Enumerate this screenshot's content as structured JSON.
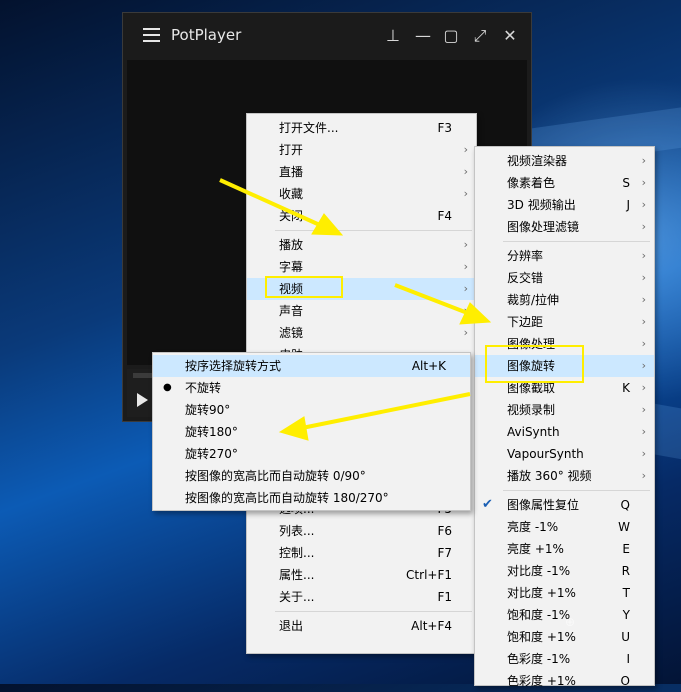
{
  "window": {
    "title": "PotPlayer",
    "buttons": [
      {
        "name": "pin-icon",
        "glyph": "⊥"
      },
      {
        "name": "minimize-icon",
        "glyph": "—"
      },
      {
        "name": "maximize-icon",
        "glyph": "▢"
      },
      {
        "name": "fullscreen-icon",
        "glyph": "⤢"
      },
      {
        "name": "close-icon",
        "glyph": "✕"
      }
    ]
  },
  "main_menu": [
    {
      "label": "打开文件...",
      "shortcut": "F3",
      "arrow": false
    },
    {
      "label": "打开",
      "shortcut": "",
      "arrow": true
    },
    {
      "label": "直播",
      "shortcut": "",
      "arrow": true
    },
    {
      "label": "收藏",
      "shortcut": "",
      "arrow": true
    },
    {
      "label": "关闭",
      "shortcut": "F4",
      "arrow": false,
      "sep_after": true
    },
    {
      "label": "播放",
      "shortcut": "",
      "arrow": true
    },
    {
      "label": "字幕",
      "shortcut": "",
      "arrow": true
    },
    {
      "label": "视频",
      "shortcut": "",
      "arrow": true,
      "highlight": true
    },
    {
      "label": "声音",
      "shortcut": "",
      "arrow": true
    },
    {
      "label": "滤镜",
      "shortcut": "",
      "arrow": true
    },
    {
      "label": "皮肤",
      "shortcut": "",
      "arrow": true
    },
    {
      "label": "",
      "shortcut": "",
      "arrow": false
    },
    {
      "label": "",
      "shortcut": "",
      "arrow": false
    },
    {
      "label": "",
      "shortcut": "",
      "arrow": false
    },
    {
      "label": "",
      "shortcut": "",
      "arrow": false
    },
    {
      "label": "",
      "shortcut": "",
      "arrow": false
    },
    {
      "label": "",
      "shortcut": "",
      "arrow": false
    },
    {
      "label": "选项...",
      "shortcut": "F5",
      "arrow": false
    },
    {
      "label": "列表...",
      "shortcut": "F6",
      "arrow": false
    },
    {
      "label": "控制...",
      "shortcut": "F7",
      "arrow": false
    },
    {
      "label": "属性...",
      "shortcut": "Ctrl+F1",
      "arrow": false
    },
    {
      "label": "关于...",
      "shortcut": "F1",
      "arrow": false,
      "sep_after": true
    },
    {
      "label": "退出",
      "shortcut": "Alt+F4",
      "arrow": false
    }
  ],
  "video_submenu": [
    {
      "label": "视频渲染器",
      "shortcut": "",
      "arrow": true
    },
    {
      "label": "像素着色",
      "shortcut": "S",
      "arrow": true
    },
    {
      "label": "3D 视频输出",
      "shortcut": "J",
      "arrow": true
    },
    {
      "label": "图像处理滤镜",
      "shortcut": "",
      "arrow": true,
      "sep_after": true
    },
    {
      "label": "分辨率",
      "shortcut": "",
      "arrow": true
    },
    {
      "label": "反交错",
      "shortcut": "",
      "arrow": true
    },
    {
      "label": "裁剪/拉伸",
      "shortcut": "",
      "arrow": true
    },
    {
      "label": "下边距",
      "shortcut": "",
      "arrow": true
    },
    {
      "label": "图像处理",
      "shortcut": "",
      "arrow": true
    },
    {
      "label": "图像旋转",
      "shortcut": "",
      "arrow": true,
      "highlight": true
    },
    {
      "label": "图像截取",
      "shortcut": "K",
      "arrow": true
    },
    {
      "label": "视频录制",
      "shortcut": "",
      "arrow": true
    },
    {
      "label": "AviSynth",
      "shortcut": "",
      "arrow": true
    },
    {
      "label": "VapourSynth",
      "shortcut": "",
      "arrow": true
    },
    {
      "label": "播放 360° 视频",
      "shortcut": "",
      "arrow": true,
      "sep_after": true
    },
    {
      "label": "图像属性复位",
      "shortcut": "Q",
      "arrow": false,
      "checked": true
    },
    {
      "label": "亮度 -1%",
      "shortcut": "W",
      "arrow": false
    },
    {
      "label": "亮度 +1%",
      "shortcut": "E",
      "arrow": false
    },
    {
      "label": "对比度 -1%",
      "shortcut": "R",
      "arrow": false
    },
    {
      "label": "对比度 +1%",
      "shortcut": "T",
      "arrow": false
    },
    {
      "label": "饱和度 -1%",
      "shortcut": "Y",
      "arrow": false
    },
    {
      "label": "饱和度 +1%",
      "shortcut": "U",
      "arrow": false
    },
    {
      "label": "色彩度 -1%",
      "shortcut": "I",
      "arrow": false
    },
    {
      "label": "色彩度 +1%",
      "shortcut": "O",
      "arrow": false
    }
  ],
  "rotation_submenu": [
    {
      "label": "按序选择旋转方式",
      "shortcut": "Alt+K",
      "highlight": true
    },
    {
      "label": "不旋转",
      "shortcut": "",
      "selected": true
    },
    {
      "label": "旋转90°",
      "shortcut": ""
    },
    {
      "label": "旋转180°",
      "shortcut": ""
    },
    {
      "label": "旋转270°",
      "shortcut": ""
    },
    {
      "label": "按图像的宽高比而自动旋转 0/90°",
      "shortcut": ""
    },
    {
      "label": "按图像的宽高比而自动旋转 180/270°",
      "shortcut": ""
    }
  ],
  "colors": {
    "highlight": "#cce8ff",
    "annotation": "#ffee00"
  }
}
